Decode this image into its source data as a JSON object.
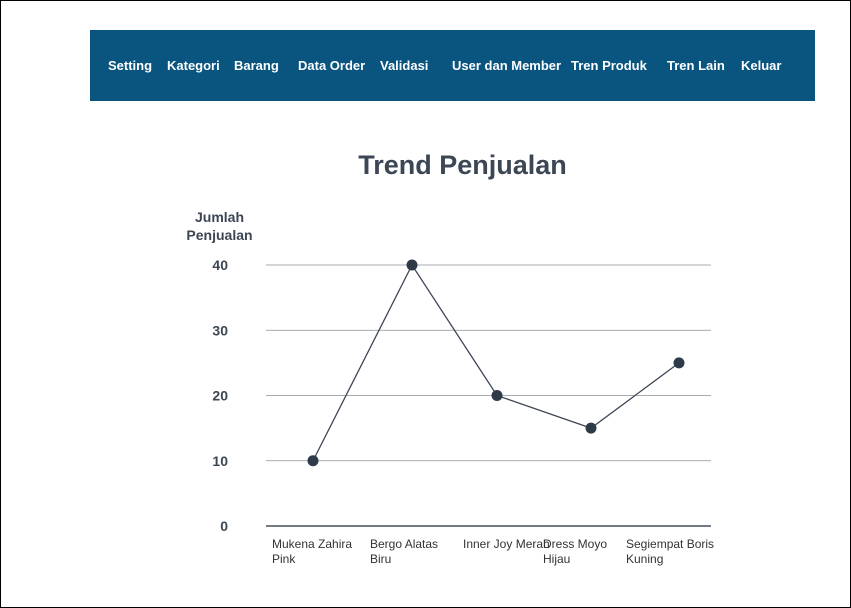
{
  "nav": {
    "items": [
      "Setting",
      "Kategori",
      "Barang",
      "Data Order",
      "Validasi",
      "User dan Member",
      "Tren Produk",
      "Tren Lain",
      "Keluar"
    ]
  },
  "colors": {
    "navbar": "#0a5580",
    "line": "#3d4654",
    "point": "#2f3a48"
  },
  "chart_data": {
    "type": "line",
    "title": "Trend Penjualan",
    "xlabel": "",
    "ylabel": "Jumlah Penjualan",
    "categories": [
      "Mukena Zahira Pink",
      "Bergo Alatas Biru",
      "Inner Joy Merah",
      "Dress Moyo Hijau",
      "Segiempat Boris Kuning"
    ],
    "series": [
      {
        "values": [
          10,
          40,
          20,
          15,
          25
        ]
      }
    ],
    "ylim": [
      0,
      40
    ],
    "yticks": [
      0,
      10,
      20,
      30,
      40
    ],
    "grid": true,
    "legend": "none"
  }
}
